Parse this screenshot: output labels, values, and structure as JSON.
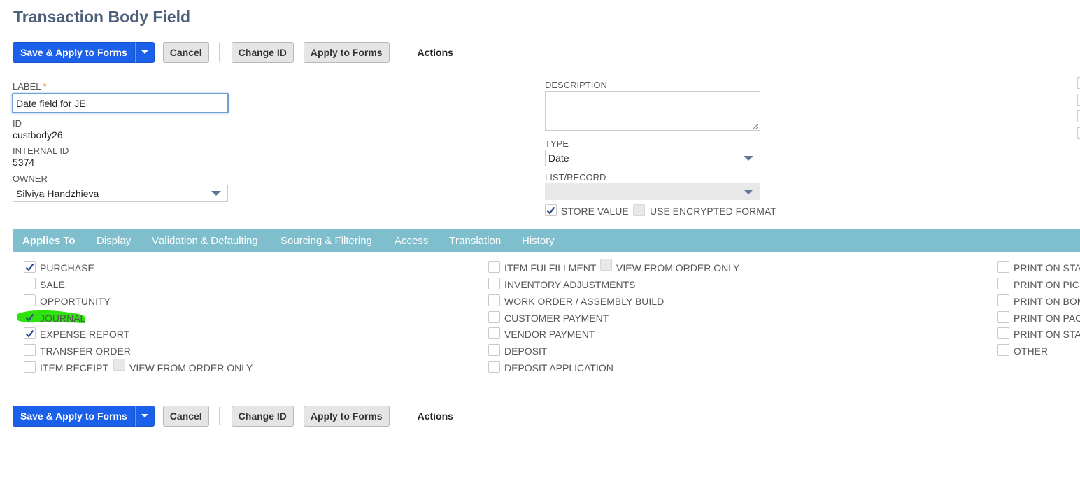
{
  "page": {
    "title": "Transaction Body Field"
  },
  "toolbar": {
    "save_label": "Save & Apply to Forms",
    "cancel_label": "Cancel",
    "change_id_label": "Change ID",
    "apply_label": "Apply to Forms",
    "actions_label": "Actions"
  },
  "fields": {
    "label": {
      "label": "LABEL",
      "required_mark": "*",
      "value": "Date field for JE"
    },
    "id": {
      "label": "ID",
      "value": "custbody26"
    },
    "internal_id": {
      "label": "INTERNAL ID",
      "value": "5374"
    },
    "owner": {
      "label": "OWNER",
      "value": "Silviya Handzhieva"
    },
    "description": {
      "label": "DESCRIPTION",
      "value": ""
    },
    "type": {
      "label": "TYPE",
      "value": "Date"
    },
    "list_record": {
      "label": "LIST/RECORD",
      "value": ""
    },
    "store_value": {
      "label": "STORE VALUE",
      "checked": true
    },
    "use_encrypted": {
      "label": "USE ENCRYPTED FORMAT",
      "checked": false
    }
  },
  "tabs": [
    {
      "underline": "A",
      "rest": "pplies To",
      "active": true
    },
    {
      "underline": "D",
      "rest": "isplay",
      "active": false
    },
    {
      "underline": "V",
      "rest": "alidation & Defaulting",
      "active": false
    },
    {
      "underline": "S",
      "rest": "ourcing & Filtering",
      "active": false
    },
    {
      "pre": "Ac",
      "underline": "c",
      "rest": "ess",
      "active": false
    },
    {
      "underline": "T",
      "rest": "ranslation",
      "active": false
    },
    {
      "underline": "H",
      "rest": "istory",
      "active": false
    }
  ],
  "applies_to": {
    "col1": [
      {
        "label": "PURCHASE",
        "checked": true
      },
      {
        "label": "SALE",
        "checked": false
      },
      {
        "label": "OPPORTUNITY",
        "checked": false
      },
      {
        "label": "JOURNAL",
        "checked": true
      },
      {
        "label": "EXPENSE REPORT",
        "checked": true
      },
      {
        "label": "TRANSFER ORDER",
        "checked": false
      },
      {
        "label": "ITEM RECEIPT",
        "checked": false
      }
    ],
    "item_receipt_view_from_order": "VIEW FROM ORDER ONLY",
    "col2": [
      {
        "label": "ITEM FULFILLMENT",
        "checked": false
      },
      {
        "label": "INVENTORY ADJUSTMENTS",
        "checked": false
      },
      {
        "label": "WORK ORDER / ASSEMBLY BUILD",
        "checked": false
      },
      {
        "label": "CUSTOMER PAYMENT",
        "checked": false
      },
      {
        "label": "VENDOR PAYMENT",
        "checked": false
      },
      {
        "label": "DEPOSIT",
        "checked": false
      },
      {
        "label": "DEPOSIT APPLICATION",
        "checked": false
      }
    ],
    "item_fulfillment_view_from_order": "VIEW FROM ORDER ONLY",
    "col3": [
      {
        "label": "PRINT ON STAN",
        "checked": false
      },
      {
        "label": "PRINT ON PICK",
        "checked": false
      },
      {
        "label": "PRINT ON BOM",
        "checked": false
      },
      {
        "label": "PRINT ON PACI",
        "checked": false
      },
      {
        "label": "PRINT ON STAT",
        "checked": false
      },
      {
        "label": "OTHER",
        "checked": false
      }
    ]
  },
  "colors": {
    "primary": "#1a60ea",
    "tabbar": "#7fbfcd",
    "title": "#4d5f79",
    "checkmark": "#2a4d8a",
    "highlight": "#22e000"
  }
}
